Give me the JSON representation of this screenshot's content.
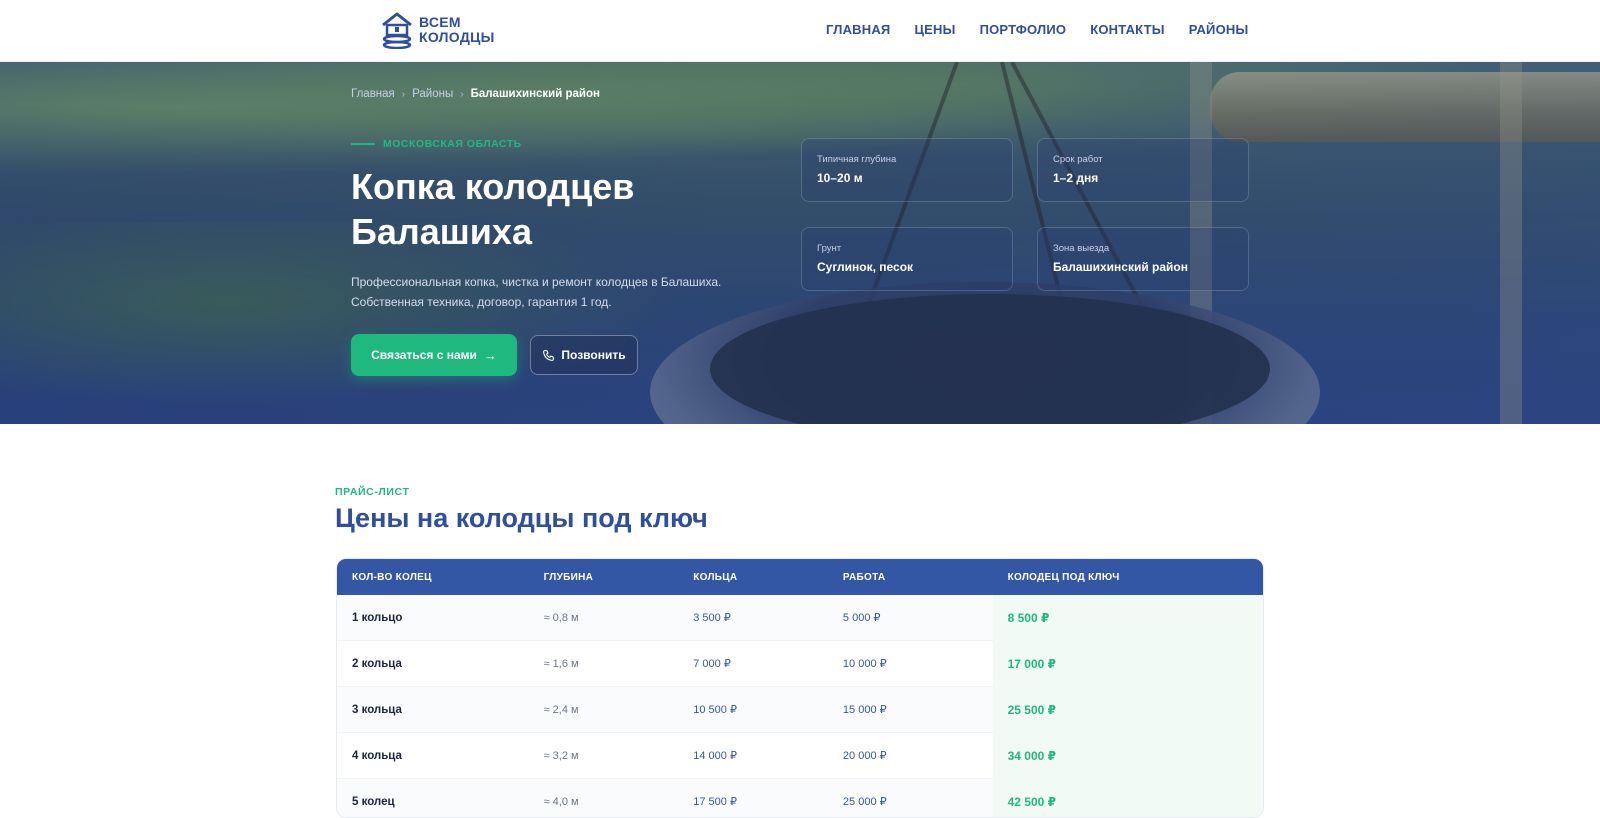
{
  "brand": {
    "line1": "ВСЕМ",
    "line2": "КОЛОДЦЫ"
  },
  "nav": [
    "ГЛАВНАЯ",
    "ЦЕНЫ",
    "ПОРТФОЛИО",
    "КОНТАКТЫ",
    "РАЙОНЫ"
  ],
  "breadcrumb": [
    "Главная",
    "Районы",
    "Балашихинский район"
  ],
  "hero": {
    "region": "МОСКОВСКАЯ ОБЛАСТЬ",
    "title_line1": "Копка колодцев",
    "title_line2": "Балашиха",
    "desc_line1": "Профессиональная копка, чистка и ремонт колодцев в Балашиха.",
    "desc_line2": "Собственная техника, договор, гарантия 1 год.",
    "cta_primary": "Связаться с нами",
    "cta_secondary": "Позвонить"
  },
  "stats": [
    {
      "label": "Типичная глубина",
      "value": "10–20 м"
    },
    {
      "label": "Срок работ",
      "value": "1–2 дня"
    },
    {
      "label": "Грунт",
      "value": "Суглинок, песок"
    },
    {
      "label": "Зона выезда",
      "value": "Балашихинский район"
    }
  ],
  "price": {
    "eyebrow": "ПРАЙС-ЛИСТ",
    "title": "Цены на колодцы под ключ",
    "headers": [
      "КОЛ-ВО КОЛЕЦ",
      "ГЛУБИНА",
      "КОЛЬЦА",
      "РАБОТА",
      "КОЛОДЕЦ ПОД КЛЮЧ"
    ],
    "rows": [
      [
        "1 кольцо",
        "≈ 0,8 м",
        "3 500 ₽",
        "5 000 ₽",
        "8 500 ₽"
      ],
      [
        "2 кольца",
        "≈ 1,6 м",
        "7 000 ₽",
        "10 000 ₽",
        "17 000 ₽"
      ],
      [
        "3 кольца",
        "≈ 2,4 м",
        "10 500 ₽",
        "15 000 ₽",
        "25 500 ₽"
      ],
      [
        "4 кольца",
        "≈ 3,2 м",
        "14 000 ₽",
        "20 000 ₽",
        "34 000 ₽"
      ],
      [
        "5 колец",
        "≈ 4,0 м",
        "17 500 ₽",
        "25 000 ₽",
        "42 500 ₽"
      ]
    ]
  },
  "colors": {
    "brand_blue": "#2f4f9a",
    "accent_green": "#1fb97f",
    "table_head": "#3457a5"
  }
}
